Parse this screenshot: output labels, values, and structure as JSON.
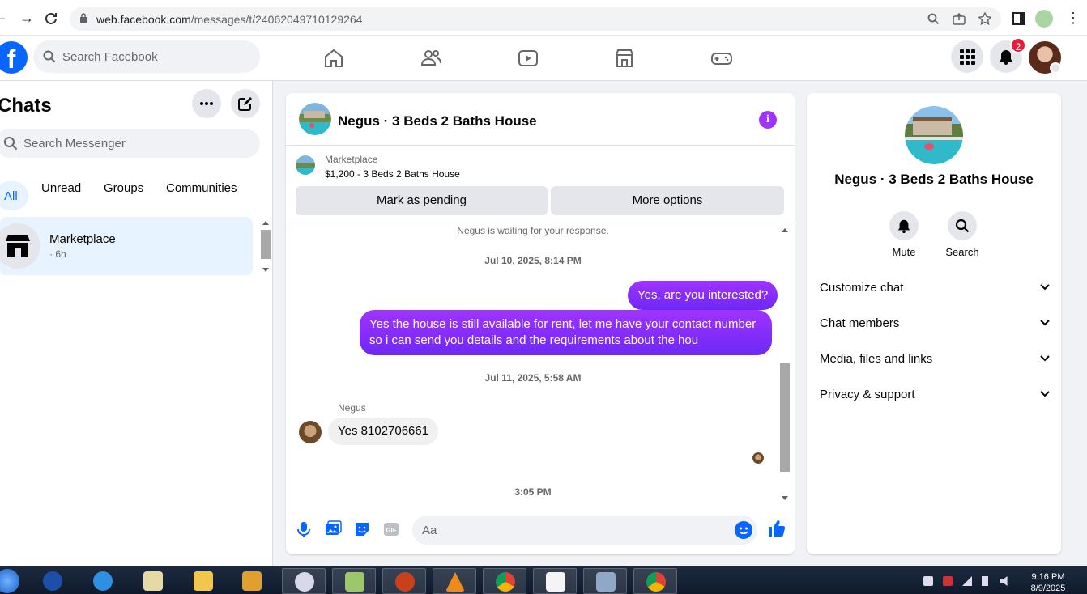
{
  "browser": {
    "url_domain": "web.facebook.com",
    "url_path": "/messages/t/24062049710129264"
  },
  "facebook": {
    "search_placeholder": "Search Facebook",
    "notification_count": "2"
  },
  "chats": {
    "title": "Chats",
    "search_placeholder": "Search Messenger",
    "filters": [
      "All",
      "Unread",
      "Groups",
      "Communities"
    ],
    "items": [
      {
        "name": "Marketplace",
        "time": "· 6h"
      }
    ]
  },
  "conversation": {
    "title": "Negus · 3 Beds 2 Baths House",
    "marketplace_label": "Marketplace",
    "listing": "$1,200 - 3 Beds 2 Baths House",
    "mark_pending_label": "Mark as pending",
    "more_options_label": "More options",
    "waiting_text": "Negus is waiting for your response.",
    "timestamp_1": "Jul 10, 2025, 8:14 PM",
    "message_out_1": "Yes, are you interested?",
    "message_out_2_line1": "Yes the house is still available for rent, let me have your contact number",
    "message_out_2_line2": "so i can send you details and the requirements about the hou",
    "timestamp_2": "Jul 11, 2025, 5:58 AM",
    "sender_name": "Negus",
    "message_in_1": "Yes 8102706661",
    "timestamp_3": "3:05 PM",
    "composer_placeholder": "Aa"
  },
  "info_panel": {
    "name": "Negus · 3 Beds 2 Baths House",
    "actions": [
      "Mute",
      "Search"
    ],
    "sections": [
      "Customize chat",
      "Chat members",
      "Media, files and links",
      "Privacy & support"
    ]
  },
  "taskbar": {
    "time": "9:16 PM",
    "date": "8/9/2025"
  },
  "colors": {
    "accent": "#0866ff",
    "outgoing_bubble": "#7b2ff7",
    "info_icon": "#a033ff",
    "badge": "#e41e3f"
  }
}
